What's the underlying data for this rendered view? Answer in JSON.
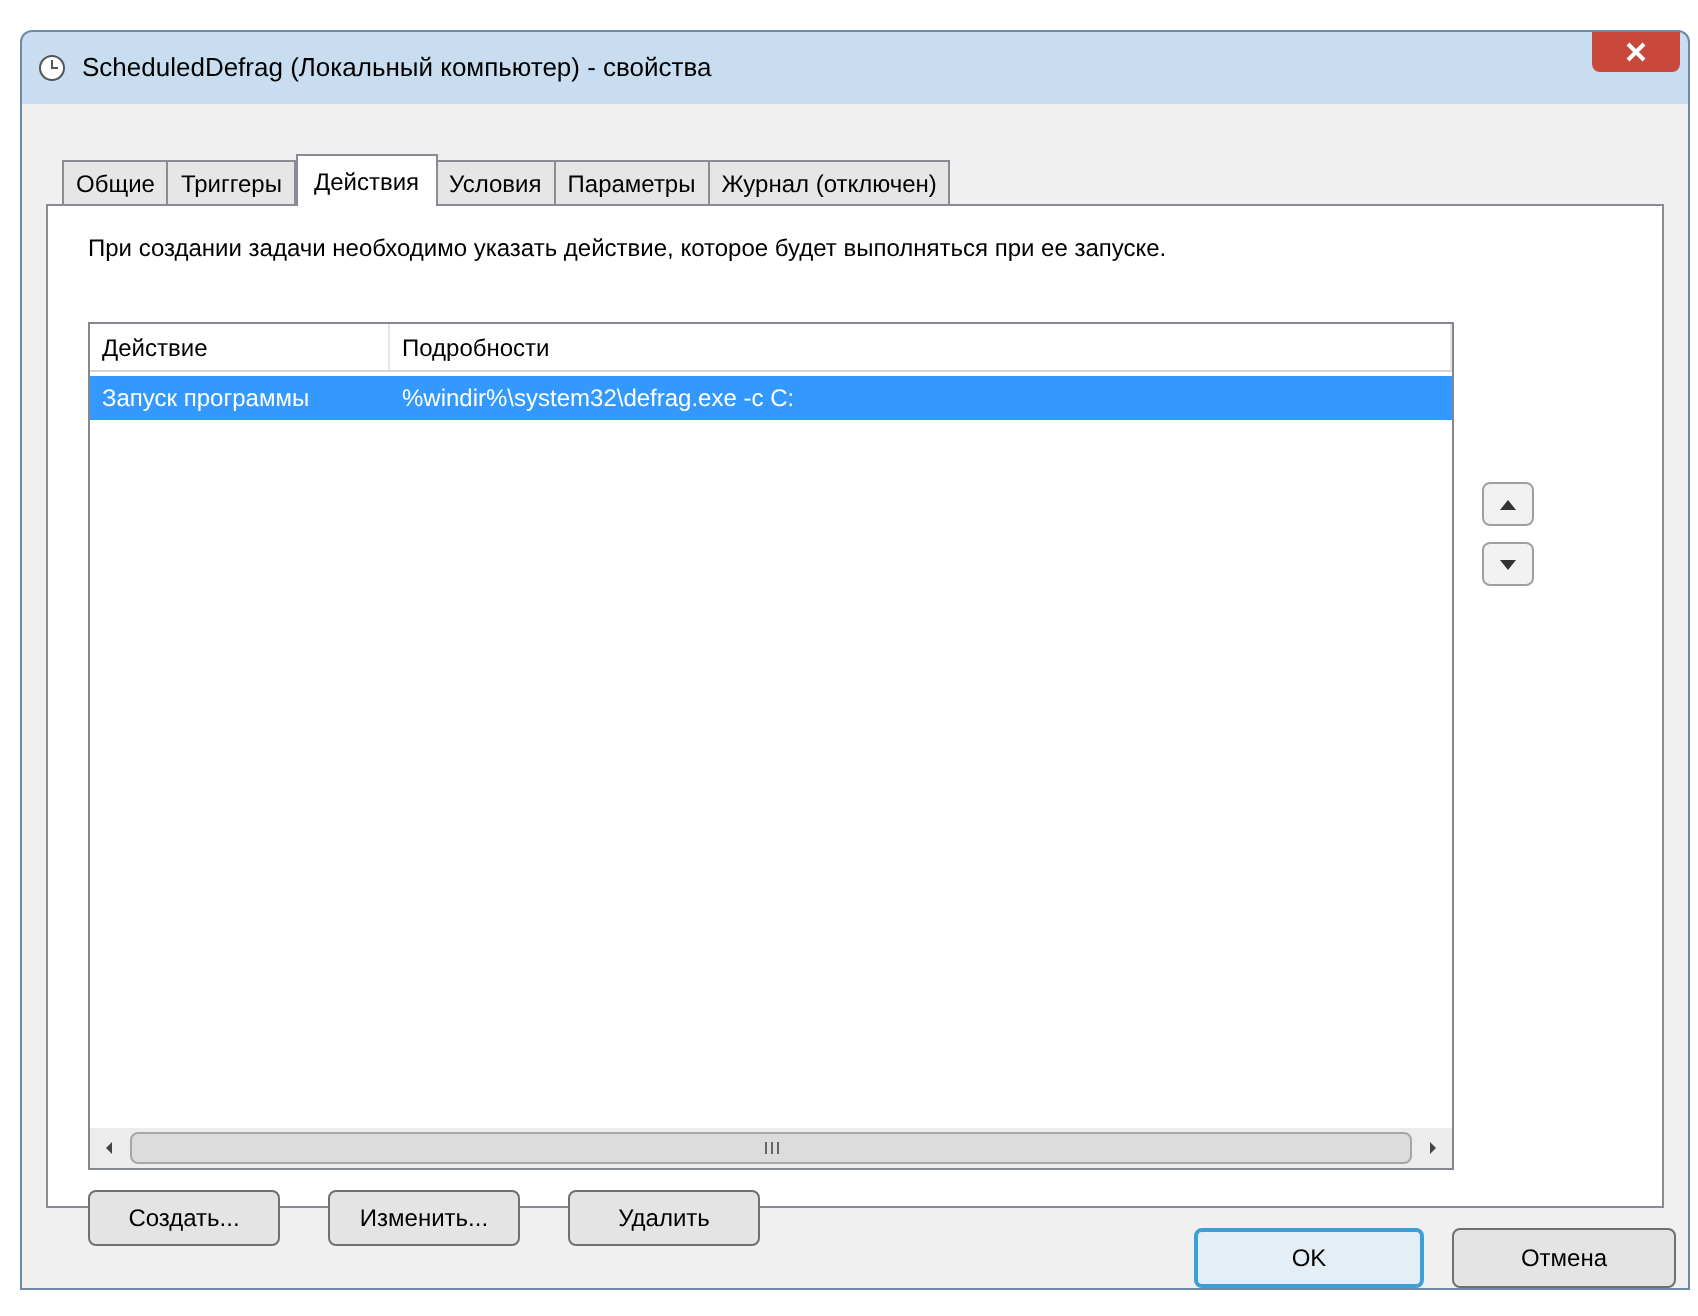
{
  "window": {
    "title": "ScheduledDefrag (Локальный компьютер) - свойства"
  },
  "tabs": [
    {
      "label": "Общие",
      "selected": false
    },
    {
      "label": "Триггеры",
      "selected": false
    },
    {
      "label": "Действия",
      "selected": true
    },
    {
      "label": "Условия",
      "selected": false
    },
    {
      "label": "Параметры",
      "selected": false
    },
    {
      "label": "Журнал (отключен)",
      "selected": false
    }
  ],
  "description": "При создании задачи необходимо указать действие, которое будет выполняться при ее запуске.",
  "table": {
    "columns": [
      "Действие",
      "Подробности"
    ],
    "rows": [
      {
        "cells": [
          "Запуск программы",
          "%windir%\\system32\\defrag.exe -c C:"
        ],
        "selected": true
      }
    ]
  },
  "action_buttons": [
    "Создать...",
    "Изменить...",
    "Удалить"
  ],
  "dialog_buttons": [
    {
      "label": "OK",
      "default": true
    },
    {
      "label": "Отмена",
      "default": false
    }
  ]
}
